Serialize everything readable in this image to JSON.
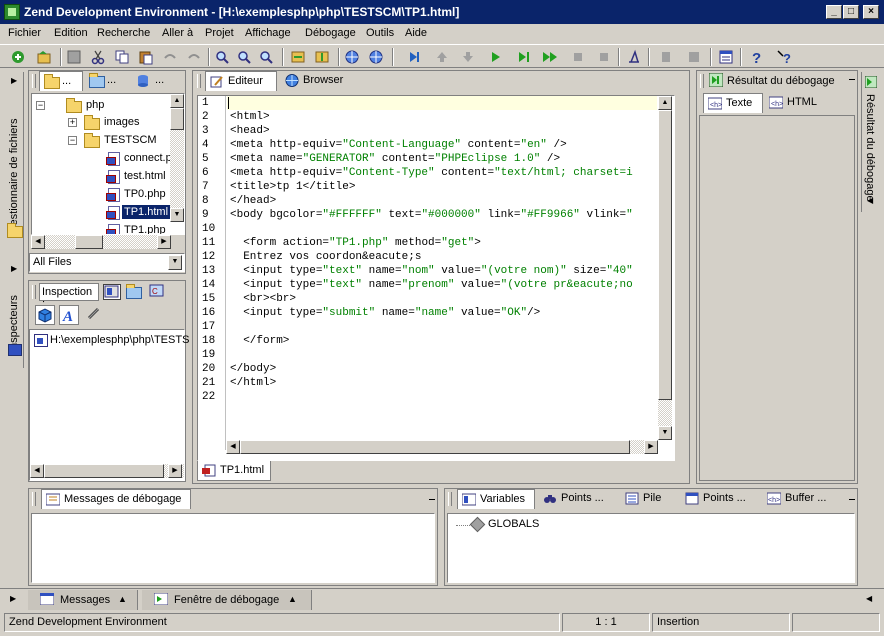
{
  "window": {
    "title": "Zend Development Environment - [H:\\exemplesphp\\php\\TESTSCM\\TP1.html]",
    "controls": [
      "_",
      "□",
      "×"
    ]
  },
  "menu": [
    "Fichier",
    "Edition",
    "Recherche",
    "Aller à",
    "Projet",
    "Affichage",
    "Débogage",
    "Outils",
    "Aide"
  ],
  "left_sidebar": {
    "file_manager_label": "Gestionnaire de fichiers",
    "inspectors_label": "Inspecteurs"
  },
  "file_panel": {
    "tabs": [
      "...",
      "...",
      "..."
    ],
    "tree": [
      {
        "label": "php",
        "type": "folder",
        "level": 0,
        "expanded": true
      },
      {
        "label": "images",
        "type": "folder",
        "level": 1,
        "expanded": false
      },
      {
        "label": "TESTSCM",
        "type": "folder",
        "level": 1,
        "expanded": true
      },
      {
        "label": "connect.p",
        "type": "file",
        "level": 2
      },
      {
        "label": "test.html",
        "type": "file",
        "level": 2
      },
      {
        "label": "TP0.php",
        "type": "file",
        "level": 2
      },
      {
        "label": "TP1.html",
        "type": "file",
        "level": 2,
        "selected": true
      },
      {
        "label": "TP1.php",
        "type": "file",
        "level": 2
      }
    ],
    "filter": "All Files"
  },
  "inspection_panel": {
    "title": "Inspection :",
    "path": "H:\\exemplesphp\\php\\TESTS"
  },
  "editor": {
    "tabs": [
      {
        "label": "Editeur",
        "active": true
      },
      {
        "label": "Browser",
        "active": false
      }
    ],
    "file_tab": "TP1.html",
    "lines": [
      "",
      "<html>",
      "<head>",
      "<meta http-equiv=\"Content-Language\" content=\"en\" />",
      "<meta name=\"GENERATOR\" content=\"PHPEclipse 1.0\" />",
      "<meta http-equiv=\"Content-Type\" content=\"text/html; charset=i",
      "<title>tp 1</title>",
      "</head>",
      "<body bgcolor=\"#FFFFFF\" text=\"#000000\" link=\"#FF9966\" vlink=\"",
      "",
      "  <form action=\"TP1.php\" method=\"get\">",
      "  Entrez vos coordon&eacute;s",
      "  <input type=\"text\" name=\"nom\" value=\"(votre nom)\" size=\"40\"",
      "  <input type=\"text\" name=\"prenom\" value=\"(votre pr&eacute;no",
      "  <br><br>",
      "  <input type=\"submit\" name=\"name\" value=\"OK\"/>",
      "",
      "  </form>",
      "",
      "</body>",
      "</html>",
      ""
    ]
  },
  "debug_result_panel": {
    "title": "Résultat du débogage",
    "tabs": [
      {
        "label": "Texte",
        "active": true
      },
      {
        "label": "HTML",
        "active": false
      }
    ],
    "side_label": "Résultat du débogage"
  },
  "debug_messages_panel": {
    "title": "Messages de débogage"
  },
  "variables_panel": {
    "tabs": [
      "Variables",
      "Points ...",
      "Pile",
      "Points ...",
      "Buffer ..."
    ],
    "items": [
      "GLOBALS"
    ]
  },
  "bottom_bar": {
    "tabs": [
      "Messages",
      "Fenêtre de débogage"
    ]
  },
  "status": {
    "app": "Zend Development Environment",
    "position": "1 : 1",
    "mode": "Insertion"
  }
}
